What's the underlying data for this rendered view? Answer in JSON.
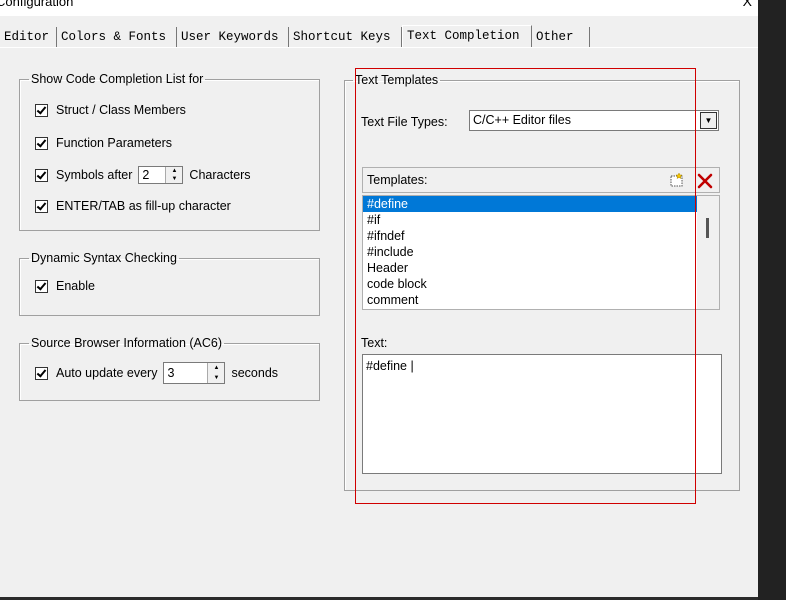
{
  "window": {
    "title": "Configuration",
    "close_glyph": "X"
  },
  "tabs": [
    "Editor",
    "Colors & Fonts",
    "User Keywords",
    "Shortcut Keys",
    "Text Completion",
    "Other"
  ],
  "active_tab": "Text Completion",
  "code_completion": {
    "legend": "Show Code Completion List for",
    "struct_members": "Struct / Class Members",
    "function_params": "Function Parameters",
    "symbols_after": "Symbols after",
    "symbols_value": "2",
    "characters": "Characters",
    "enter_tab": "ENTER/TAB as fill-up character"
  },
  "syntax_checking": {
    "legend": "Dynamic Syntax Checking",
    "enable": "Enable"
  },
  "source_browser": {
    "legend": "Source Browser Information (AC6)",
    "auto_update": "Auto update every",
    "interval_value": "3",
    "seconds": "seconds"
  },
  "text_templates": {
    "legend": "Text Templates",
    "file_types_label": "Text File Types:",
    "file_types_value": "C/C++ Editor files",
    "templates_label": "Templates:",
    "templates": [
      "#define",
      "#if",
      "#ifndef",
      "#include",
      "Header",
      "code block",
      "comment"
    ],
    "selected_template": "#define",
    "text_label": "Text:",
    "text_value": "#define |"
  },
  "colors": {
    "selection": "#0078d7",
    "highlight_box": "#d00000",
    "delete_icon": "#c00000"
  }
}
